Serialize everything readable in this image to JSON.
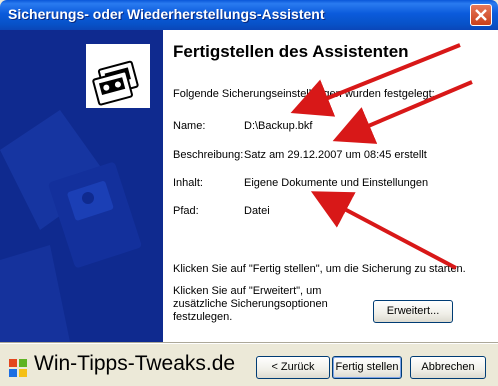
{
  "window": {
    "title": "Sicherungs- oder Wiederherstellungs-Assistent"
  },
  "page": {
    "heading": "Fertigstellen des Assistenten",
    "intro": "Folgende Sicherungseinstellungen wurden festgelegt:",
    "details": [
      {
        "label": "Name:",
        "value": "D:\\Backup.bkf"
      },
      {
        "label": "Beschreibung:",
        "value": "Satz am 29.12.2007 um 08:45 erstellt"
      },
      {
        "label": "Inhalt:",
        "value": "Eigene Dokumente und Einstellungen"
      },
      {
        "label": "Pfad:",
        "value": "Datei"
      }
    ],
    "finish_hint": "Klicken Sie auf \"Fertig stellen\", um die Sicherung zu starten.",
    "advanced_hint": "Klicken Sie auf \"Erweitert\", um zusätzliche Sicherungsoptionen festzulegen.",
    "advanced_button": "Erweitert..."
  },
  "footer": {
    "watermark": "Win-Tipps-Tweaks.de",
    "back_button": "< Zurück",
    "finish_button": "Fertig stellen",
    "cancel_button": "Abbrechen"
  },
  "colors": {
    "titlebar": "#0b5bdc",
    "banner": "#0f2a8f",
    "annotation": "#d81818"
  },
  "icons": [
    "close-icon",
    "backup-tape-icon",
    "windows-flag-icon",
    "annotation-arrow"
  ]
}
